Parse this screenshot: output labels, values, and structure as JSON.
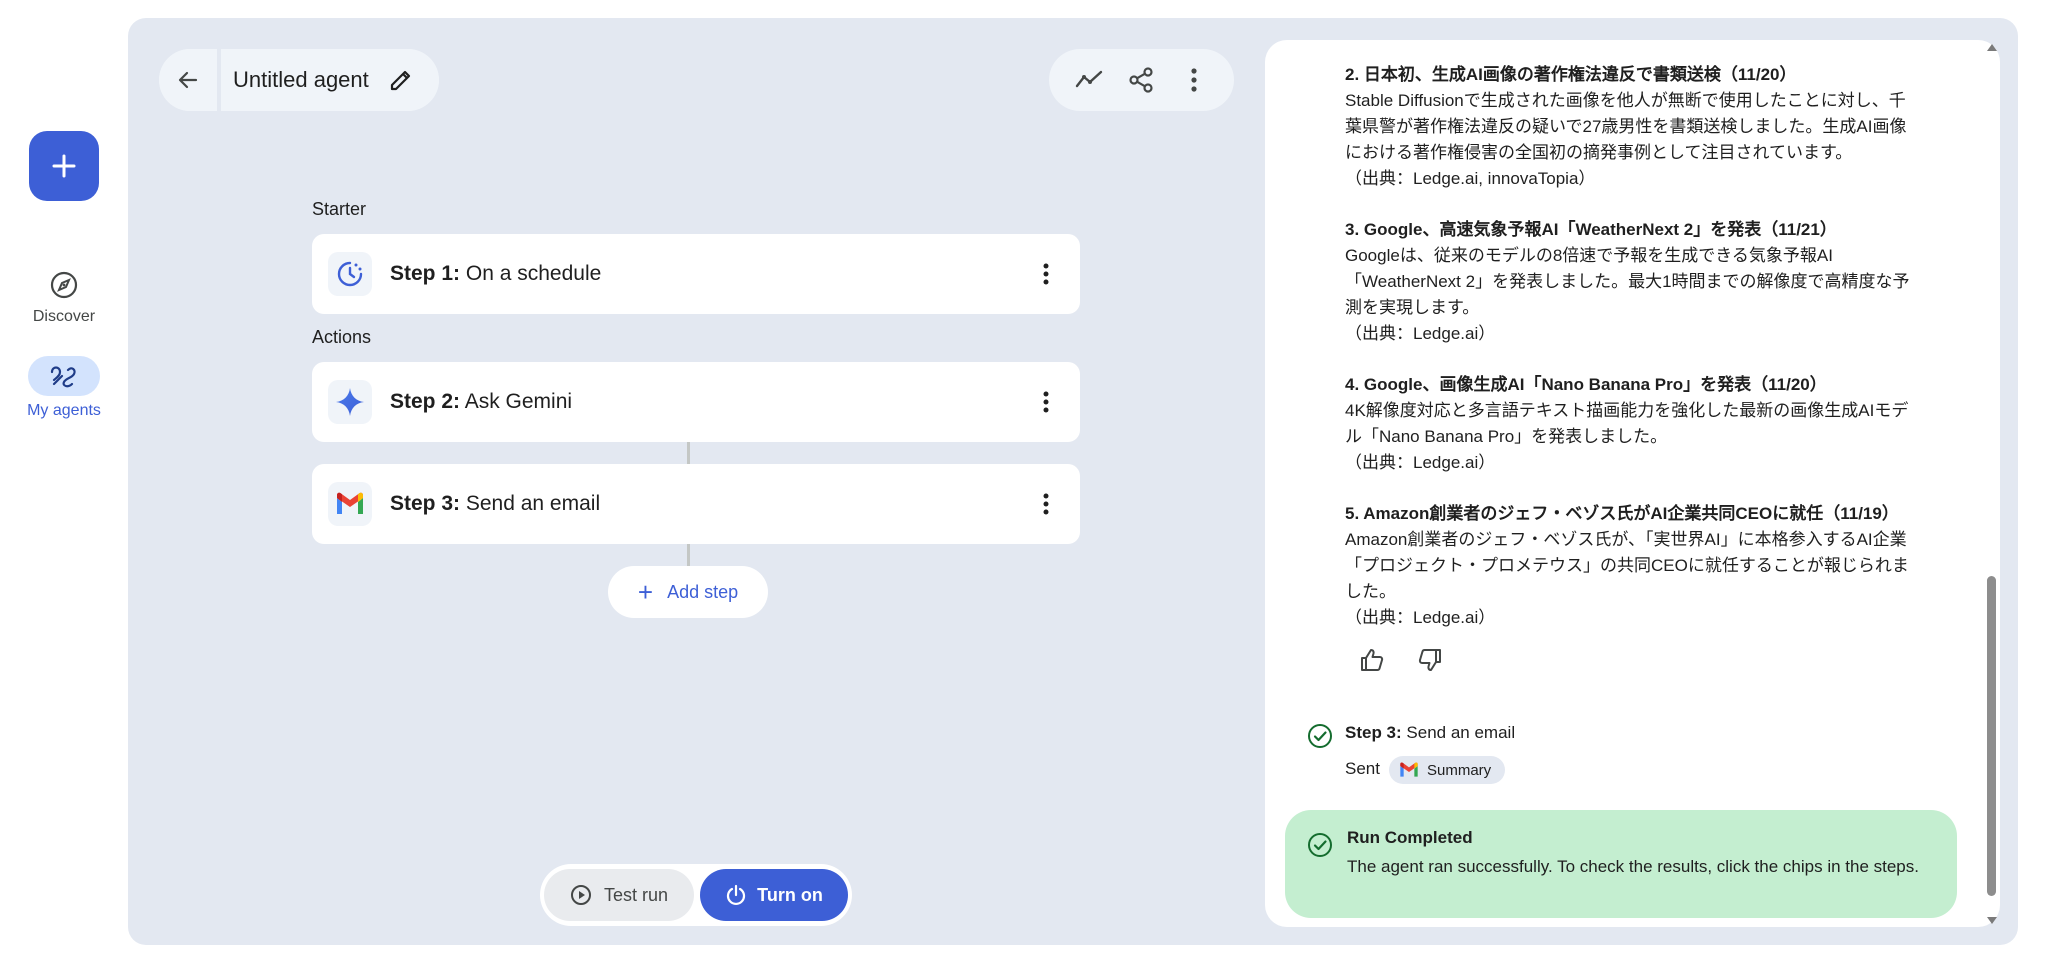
{
  "rail": {
    "discover_label": "Discover",
    "my_agents_label": "My agents"
  },
  "header": {
    "title": "Untitled agent"
  },
  "sections": {
    "starter": "Starter",
    "actions": "Actions"
  },
  "steps": [
    {
      "prefix": "Step 1:",
      "label": "On a schedule"
    },
    {
      "prefix": "Step 2:",
      "label": "Ask Gemini"
    },
    {
      "prefix": "Step 3:",
      "label": "Send an email"
    }
  ],
  "add_step_label": "Add step",
  "run_controls": {
    "test_run": "Test run",
    "turn_on": "Turn on"
  },
  "results": {
    "news": [
      {
        "title": "2. 日本初、生成AI画像の著作権法違反で書類送検（11/20）",
        "lines": [
          "Stable Diffusionで生成された画像を他人が無断で使用したことに対し、千",
          "葉県警が著作権法違反の疑いで27歳男性を書類送検しました。生成AI画像",
          "における著作権侵害の全国初の摘発事例として注目されています。",
          "（出典：Ledge.ai, innovaTopia）"
        ]
      },
      {
        "title": "3. Google、高速気象予報AI「WeatherNext 2」を発表（11/21）",
        "lines": [
          "Googleは、従来のモデルの8倍速で予報を生成できる気象予報AI",
          "「WeatherNext 2」を発表しました。最大1時間までの解像度で高精度な予",
          "測を実現します。",
          "（出典：Ledge.ai）"
        ]
      },
      {
        "title": "4. Google、画像生成AI「Nano Banana Pro」を発表（11/20）",
        "lines": [
          "4K解像度対応と多言語テキスト描画能力を強化した最新の画像生成AIモデ",
          "ル「Nano Banana Pro」を発表しました。",
          "（出典：Ledge.ai）"
        ]
      },
      {
        "title": "5. Amazon創業者のジェフ・ベゾス氏がAI企業共同CEOに就任（11/19）",
        "lines": [
          "Amazon創業者のジェフ・ベゾス氏が、「実世界AI」に本格参入するAI企業",
          "「プロジェクト・プロメテウス」の共同CEOに就任することが報じられま",
          "した。",
          "（出典：Ledge.ai）"
        ]
      }
    ],
    "step3": {
      "prefix": "Step 3:",
      "label": "Send an email",
      "sent_label": "Sent",
      "chip_label": "Summary"
    },
    "run_completed": {
      "title": "Run Completed",
      "description": "The agent ran successfully. To check the results, click the chips in the steps."
    }
  },
  "colors": {
    "accent": "#3d5fd6",
    "panel_bg": "#e3e8f1",
    "success_bg": "#c4eed0",
    "success_icon": "#146c2e"
  }
}
